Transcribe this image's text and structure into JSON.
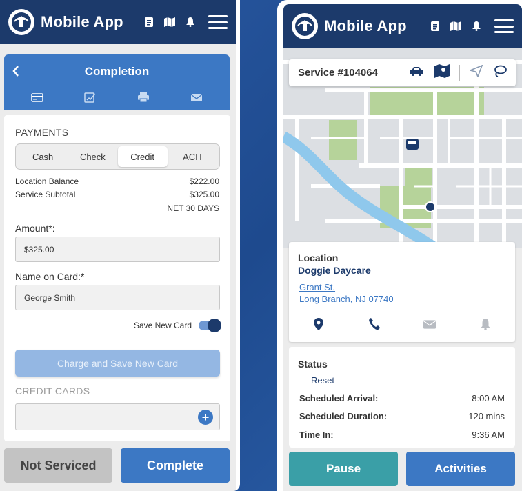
{
  "app": {
    "title": "Mobile App"
  },
  "left": {
    "header": {
      "title": "Completion"
    },
    "payments": {
      "section_label": "PAYMENTS",
      "methods": [
        "Cash",
        "Check",
        "Credit",
        "ACH"
      ],
      "selected_method": "Credit",
      "location_balance_label": "Location Balance",
      "location_balance_value": "$222.00",
      "service_subtotal_label": "Service Subtotal",
      "service_subtotal_value": "$325.00",
      "terms": "NET 30 DAYS",
      "amount_label": "Amount*:",
      "amount_value": "$325.00",
      "name_label": "Name on Card:*",
      "name_value": "George Smith",
      "save_card_label": "Save New Card",
      "save_card_on": true,
      "charge_button": "Charge and Save New Card",
      "credit_cards_label": "CREDIT CARDS"
    },
    "actions": {
      "not_serviced": "Not Serviced",
      "complete": "Complete"
    }
  },
  "right": {
    "service_title": "Service #104064",
    "location": {
      "label": "Location",
      "name": "Doggie Daycare",
      "address_line1": "Grant St.",
      "address_line2": "Long Branch, NJ 07740"
    },
    "status": {
      "label": "Status",
      "reset": "Reset",
      "rows": [
        {
          "key": "Scheduled Arrival:",
          "value": "8:00 AM"
        },
        {
          "key": "Scheduled Duration:",
          "value": "120 mins"
        },
        {
          "key": "Time In:",
          "value": "9:36 AM"
        }
      ]
    },
    "actions": {
      "pause": "Pause",
      "activities": "Activities"
    }
  },
  "colors": {
    "appbar": "#1c3a6b",
    "primary": "#3c78c4",
    "teal": "#3a9fa7",
    "background": "#2a5aa4"
  },
  "icons": [
    "logo-icon",
    "document-icon",
    "map-icon",
    "bell-icon",
    "menu-icon",
    "chevron-left-icon",
    "credit-card-icon",
    "signature-icon",
    "printer-icon",
    "envelope-icon",
    "plus-icon",
    "car-icon",
    "map-route-icon",
    "navigation-icon",
    "lasso-icon",
    "location-pin-icon",
    "phone-icon",
    "van-icon"
  ]
}
